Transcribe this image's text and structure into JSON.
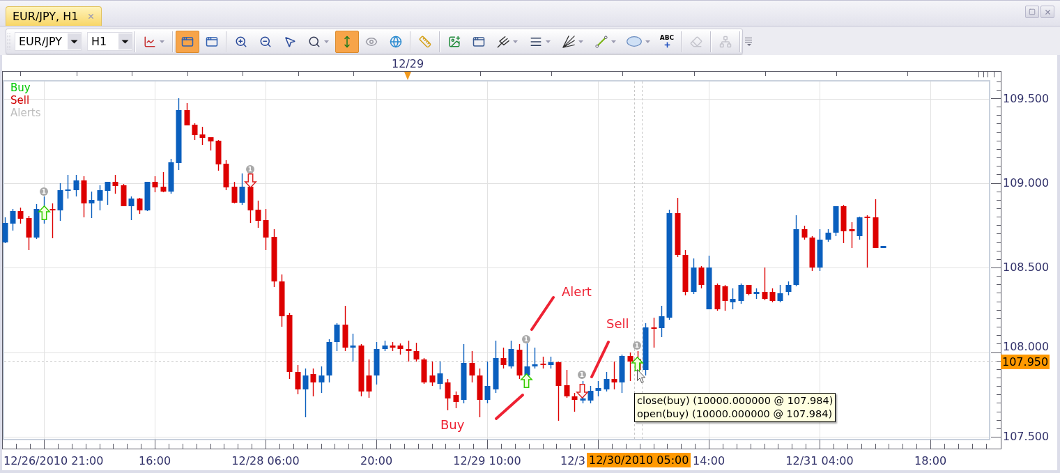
{
  "tabs": [
    {
      "title": "EUR/JPY, H1",
      "selected": true
    }
  ],
  "toolbar": {
    "symbol": "EUR/JPY",
    "timeframe": "H1",
    "groups": [
      {
        "buttons": [
          {
            "kind": "chart-type",
            "on": false,
            "disabled": false,
            "dropdown": true
          }
        ]
      },
      {
        "buttons": [
          {
            "kind": "window",
            "on": true,
            "disabled": false,
            "dropdown": false
          },
          {
            "kind": "window",
            "on": false,
            "disabled": false,
            "dropdown": false
          }
        ]
      },
      {
        "buttons": [
          {
            "kind": "zoom-in",
            "on": false,
            "disabled": false,
            "dropdown": false
          },
          {
            "kind": "zoom-out",
            "on": false,
            "disabled": false,
            "dropdown": false
          },
          {
            "kind": "pointer",
            "on": false,
            "disabled": false,
            "dropdown": false
          },
          {
            "kind": "scale",
            "on": false,
            "disabled": false,
            "dropdown": true
          },
          {
            "kind": "vertical-arrows",
            "on": true,
            "disabled": false,
            "dropdown": false
          },
          {
            "kind": "eye",
            "on": false,
            "disabled": false,
            "dropdown": false
          },
          {
            "kind": "globe",
            "on": false,
            "disabled": false,
            "dropdown": false
          }
        ]
      },
      {
        "buttons": [
          {
            "kind": "ruler",
            "on": false,
            "disabled": false,
            "dropdown": false
          }
        ]
      },
      {
        "buttons": [
          {
            "kind": "image-add",
            "on": false,
            "disabled": false,
            "dropdown": false
          },
          {
            "kind": "chart-window",
            "on": false,
            "disabled": false,
            "dropdown": false
          },
          {
            "kind": "pitchfork",
            "on": false,
            "disabled": false,
            "dropdown": true
          },
          {
            "kind": "lines",
            "on": false,
            "disabled": false,
            "dropdown": true
          },
          {
            "kind": "fan",
            "on": false,
            "disabled": false,
            "dropdown": true
          },
          {
            "kind": "line",
            "on": false,
            "disabled": false,
            "dropdown": true
          },
          {
            "kind": "ellipse",
            "on": false,
            "disabled": false,
            "dropdown": true
          },
          {
            "kind": "text",
            "label": "ABC",
            "on": false,
            "disabled": false,
            "dropdown": false
          }
        ]
      },
      {
        "buttons": [
          {
            "kind": "eraser",
            "on": false,
            "disabled": true,
            "dropdown": false
          }
        ]
      },
      {
        "buttons": [
          {
            "kind": "hierarchy",
            "on": false,
            "disabled": true,
            "dropdown": false
          }
        ]
      },
      {
        "buttons": [
          {
            "kind": "overflow",
            "on": false,
            "disabled": false,
            "dropdown": false
          }
        ]
      }
    ]
  },
  "chart": {
    "date_marker": "12/29",
    "legend": [
      {
        "label": "Buy",
        "color": "#00c800"
      },
      {
        "label": "Sell",
        "color": "#d00000"
      },
      {
        "label": "Alerts",
        "color": "#bdbdbd"
      }
    ],
    "price_axis": [
      "109.500",
      "109.000",
      "108.500",
      "108.000",
      "107.500"
    ],
    "current_price": "107.950",
    "time_axis": [
      "12/26/2010 21:00",
      "16:00",
      "12/28 06:00",
      "20:00",
      "12/29 10:00",
      "12/3",
      "14:00",
      "12/31 04:00",
      "18:00"
    ],
    "cursor_time": "12/30/2010 05:00",
    "signals": [
      {
        "kind": "buy",
        "alert": "1"
      },
      {
        "kind": "sell",
        "alert": "1"
      },
      {
        "kind": "buy",
        "alert": "1"
      },
      {
        "kind": "sell",
        "alert": "1"
      },
      {
        "kind": "buy",
        "alert": "1"
      }
    ],
    "annotations": [
      {
        "text": "Alert"
      },
      {
        "text": "Sell"
      },
      {
        "text": "Buy"
      }
    ],
    "tooltip": [
      "close(buy) (10000.000000 @ 107.984)",
      "open(buy) (10000.000000 @ 107.984)"
    ]
  }
}
